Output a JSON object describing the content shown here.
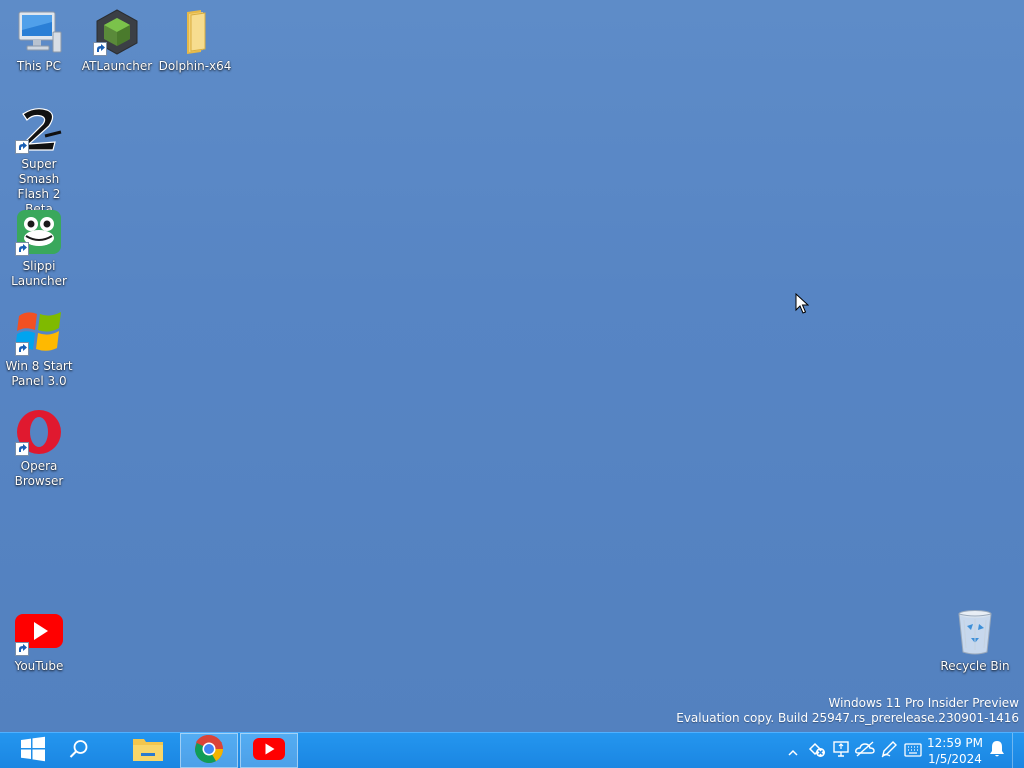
{
  "desktop": {
    "icons": [
      {
        "label": "This PC",
        "icon": "computer-icon"
      },
      {
        "label": "ATLauncher",
        "icon": "atlauncher-icon"
      },
      {
        "label": "Dolphin-x64",
        "icon": "folder-icon"
      },
      {
        "label": "Super Smash Flash 2 Beta",
        "icon": "ssf2-icon"
      },
      {
        "label": "Slippi Launcher",
        "icon": "slippi-frog-icon"
      },
      {
        "label": "Win 8 Start Panel 3.0",
        "icon": "windows-flag-icon"
      },
      {
        "label": "Opera Browser",
        "icon": "opera-icon"
      },
      {
        "label": "YouTube",
        "icon": "youtube-icon"
      },
      {
        "label": "Recycle Bin",
        "icon": "recycle-bin-icon"
      }
    ]
  },
  "watermark": {
    "line1": "Windows 11 Pro Insider Preview",
    "line2": "Evaluation copy. Build 25947.rs_prerelease.230901-1416"
  },
  "taskbar": {
    "buttons": [
      {
        "icon": "windows-start-icon"
      },
      {
        "icon": "search-icon"
      },
      {
        "icon": "file-explorer-icon"
      },
      {
        "icon": "chrome-icon",
        "active": true
      },
      {
        "icon": "youtube-icon",
        "active": true
      }
    ],
    "tray": {
      "icons": [
        "chevron-up-icon",
        "network-disconnected-icon",
        "display-icon",
        "onedrive-icon",
        "pen-icon",
        "keyboard-icon",
        "notification-bell-icon"
      ],
      "time": "12:59 PM",
      "date": "1/5/2024"
    }
  },
  "colors": {
    "desktop_bg": "#5584c3",
    "taskbar_bg": "#1e88e5"
  }
}
